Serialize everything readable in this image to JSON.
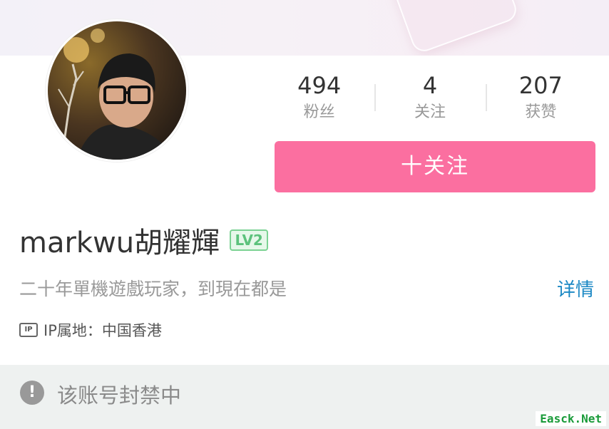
{
  "profile": {
    "stats": [
      {
        "value": "494",
        "label": "粉丝"
      },
      {
        "value": "4",
        "label": "关注"
      },
      {
        "value": "207",
        "label": "获赞"
      }
    ],
    "follow_label": "十关注",
    "name": "markwu胡耀輝",
    "level": "LV2",
    "bio": "二十年單機遊戲玩家，到現在都是",
    "detail_label": "详情",
    "ip_icon": "IP",
    "ip_location": "IP属地：中国香港"
  },
  "notice": {
    "icon": "!",
    "text": "该账号封禁中"
  },
  "watermark": "Easck.Net",
  "colors": {
    "accent": "#fb6fa0",
    "link": "#1b88c4",
    "level": "#5cc27c"
  }
}
